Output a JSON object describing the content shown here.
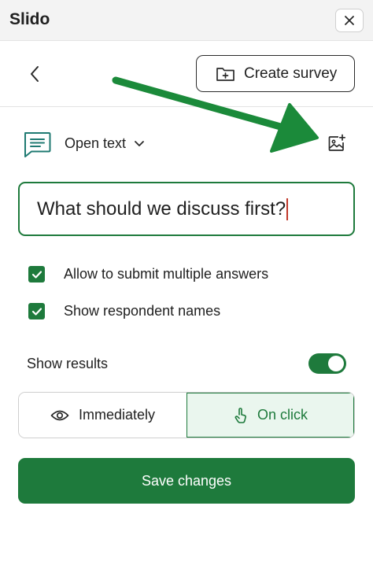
{
  "app": {
    "title": "Slido"
  },
  "toolbar": {
    "create_survey_label": "Create survey"
  },
  "question": {
    "type_label": "Open text",
    "text": "What should we discuss first?"
  },
  "options": [
    {
      "label": "Allow to submit multiple answers",
      "checked": true
    },
    {
      "label": "Show respondent names",
      "checked": true
    }
  ],
  "results": {
    "label": "Show results",
    "enabled": true,
    "timing": [
      {
        "label": "Immediately",
        "selected": false
      },
      {
        "label": "On click",
        "selected": true
      }
    ]
  },
  "save_label": "Save changes",
  "icons": {
    "close": "close-icon",
    "back": "chevron-left-icon",
    "survey": "folder-plus-icon",
    "poll_type": "chat-lines-icon",
    "dropdown": "chevron-down-icon",
    "add_image": "image-plus-icon",
    "check": "checkmark-icon",
    "immediately": "eye-icon",
    "on_click": "pointer-icon"
  },
  "colors": {
    "accent": "#1e7a3c",
    "accent_light": "#eaf6ee",
    "annotation": "#1b8a3a"
  }
}
